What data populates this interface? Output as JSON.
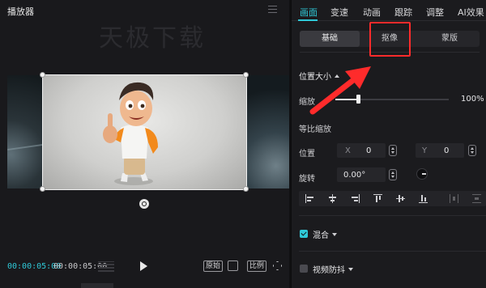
{
  "player": {
    "title": "播放器",
    "watermark": "天极下载",
    "time_current": "00:00:05:00",
    "time_total": "00:00:05:00",
    "ratio_original": "原始",
    "ratio_aspect": "比例"
  },
  "inspector": {
    "tabs": [
      "画面",
      "变速",
      "动画",
      "跟踪",
      "调整",
      "AI效果"
    ],
    "active_tab": "画面",
    "sub_tabs": [
      "基础",
      "抠像",
      "蒙版"
    ],
    "selected_sub_tab": "基础",
    "position_size": {
      "title": "位置大小",
      "scale_label": "缩放",
      "scale_value": "100%",
      "scale_percent": 100,
      "uniform_scale_label": "等比缩放",
      "position_label": "位置",
      "x_axis": "X",
      "x_value": "0",
      "y_axis": "Y",
      "y_value": "0",
      "rotate_label": "旋转",
      "rotate_value": "0.00°"
    },
    "blend": {
      "label": "混合",
      "checked": true
    },
    "stabilize": {
      "label": "视频防抖",
      "checked": false
    }
  },
  "colors": {
    "accent": "#2fc9d8",
    "highlight": "#ff2b2b"
  },
  "icons": [
    "menu-icon",
    "rotate-icon",
    "grid-icon",
    "play-icon",
    "crop-icon",
    "expand-icon",
    "rotate-dial-icon",
    "align-left-icon",
    "align-center-h-icon",
    "align-right-icon",
    "align-top-icon",
    "align-center-v-icon",
    "align-bottom-icon",
    "distribute-h-icon",
    "distribute-v-icon"
  ]
}
